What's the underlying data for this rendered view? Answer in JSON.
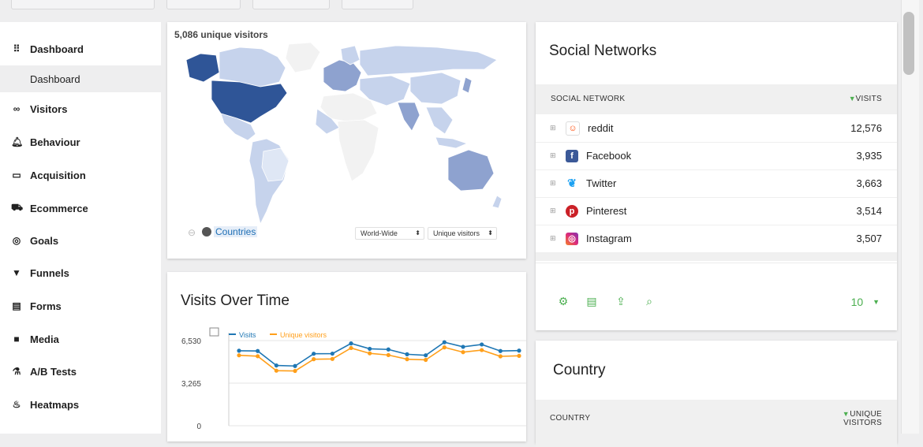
{
  "sidebar": {
    "items": [
      {
        "label": "Dashboard",
        "icon": "dashboard-grid-icon"
      },
      {
        "label": "Visitors",
        "icon": "binoculars-icon"
      },
      {
        "label": "Behaviour",
        "icon": "bell-icon"
      },
      {
        "label": "Acquisition",
        "icon": "window-icon"
      },
      {
        "label": "Ecommerce",
        "icon": "cart-icon"
      },
      {
        "label": "Goals",
        "icon": "target-icon"
      },
      {
        "label": "Funnels",
        "icon": "funnel-icon"
      },
      {
        "label": "Forms",
        "icon": "form-icon"
      },
      {
        "label": "Media",
        "icon": "media-icon"
      },
      {
        "label": "A/B Tests",
        "icon": "flask-icon"
      },
      {
        "label": "Heatmaps",
        "icon": "flame-icon"
      }
    ],
    "sub_item": "Dashboard"
  },
  "map_widget": {
    "title": "5,086 unique visitors",
    "countries_link": "Countries",
    "region_select": "World-Wide",
    "metric_select": "Unique visitors",
    "colors": {
      "high": "#2f5597",
      "mid": "#8ea2cf",
      "low": "#c6d3ec",
      "none": "#f2f2f2"
    }
  },
  "visits_widget": {
    "title": "Visits Over Time",
    "legend": [
      "Visits",
      "Unique visitors"
    ]
  },
  "chart_data": {
    "type": "line",
    "x": [
      "1",
      "2",
      "3",
      "4",
      "5",
      "6",
      "7",
      "8",
      "9",
      "10",
      "11",
      "12",
      "13",
      "14",
      "15",
      "16"
    ],
    "ylim": [
      0,
      6530
    ],
    "yticks": [
      "6,530",
      "3,265",
      "0"
    ],
    "series": [
      {
        "name": "Visits",
        "color": "#1f77b4",
        "values": [
          5750,
          5730,
          4620,
          4580,
          5520,
          5530,
          6310,
          5900,
          5850,
          5480,
          5400,
          6400,
          6050,
          6230,
          5730,
          5760
        ]
      },
      {
        "name": "Unique visitors",
        "color": "#ff9f1a",
        "values": [
          5400,
          5330,
          4220,
          4200,
          5100,
          5120,
          5960,
          5550,
          5420,
          5100,
          5050,
          6010,
          5640,
          5800,
          5320,
          5360
        ]
      }
    ]
  },
  "social_widget": {
    "title": "Social Networks",
    "col_network": "SOCIAL NETWORK",
    "col_visits": "VISITS",
    "rows": [
      {
        "name": "reddit",
        "visits": "12,576",
        "icon": "reddit-icon",
        "color": "#ffffff"
      },
      {
        "name": "Facebook",
        "visits": "3,935",
        "icon": "facebook-icon",
        "color": "#3b5998"
      },
      {
        "name": "Twitter",
        "visits": "3,663",
        "icon": "twitter-icon",
        "color": "#1da1f2"
      },
      {
        "name": "Pinterest",
        "visits": "3,514",
        "icon": "pinterest-icon",
        "color": "#cb2027"
      },
      {
        "name": "Instagram",
        "visits": "3,507",
        "icon": "instagram-icon",
        "color": "#c13584"
      }
    ],
    "limit": "10"
  },
  "country_widget": {
    "title": "Country",
    "col_country": "COUNTRY",
    "col_unique_1": "UNIQUE",
    "col_unique_2": "VISITORS"
  }
}
